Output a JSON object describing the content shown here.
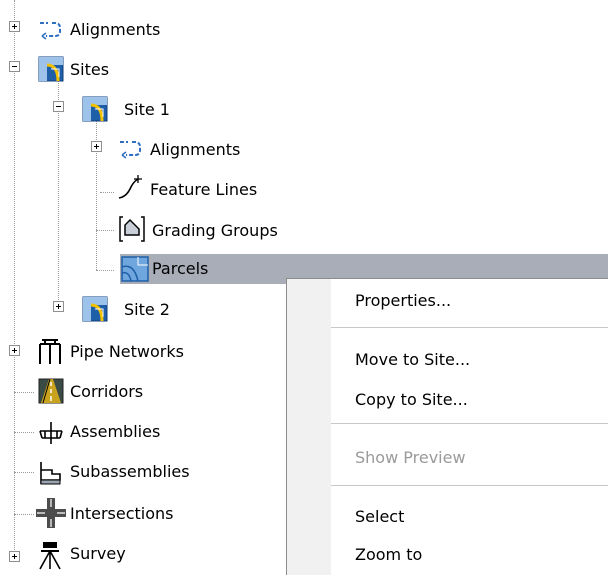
{
  "tree": {
    "top_alignments": "Alignments",
    "sites": "Sites",
    "site1": "Site 1",
    "site1_alignments": "Alignments",
    "feature_lines": "Feature Lines",
    "grading_groups": "Grading Groups",
    "parcels": "Parcels",
    "site2": "Site 2",
    "pipe_networks": "Pipe Networks",
    "corridors": "Corridors",
    "assemblies": "Assemblies",
    "subassemblies": "Subassemblies",
    "intersections": "Intersections",
    "survey": "Survey"
  },
  "context_menu": {
    "properties": "Properties...",
    "move_to_site": "Move to Site...",
    "copy_to_site": "Copy to Site...",
    "show_preview": "Show Preview",
    "select": "Select",
    "zoom_to": "Zoom to"
  },
  "colors": {
    "selection": "#a9adb8",
    "disabled_text": "#9a9a9a",
    "site_icon_blue": "#1f5fa8",
    "site_icon_yellow": "#f2c200"
  },
  "icons": {
    "alignment": "alignment-icon",
    "site": "site-icon",
    "feature_line": "feature-line-icon",
    "grading_group": "grading-group-icon",
    "parcel": "parcel-icon",
    "pipe_network": "pipe-network-icon",
    "corridor": "corridor-icon",
    "assembly": "assembly-icon",
    "subassembly": "subassembly-icon",
    "intersection": "intersection-icon",
    "survey": "survey-icon"
  }
}
